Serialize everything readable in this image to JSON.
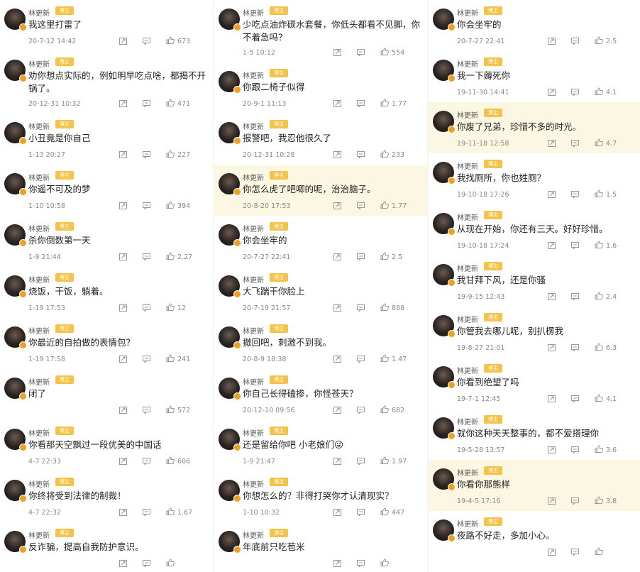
{
  "columns": [
    [
      {
        "name": "林更新",
        "badge": "博主",
        "text": "我这里打雷了",
        "date": "20-7-12 14:42",
        "likes": "673",
        "hl": false
      },
      {
        "name": "林更新",
        "badge": "博主",
        "text": "劝你想点实际的，例如明早吃点啥，都揭不开锅了。",
        "date": "20-12-31 10:32",
        "likes": "471",
        "hl": false,
        "tall": true
      },
      {
        "name": "林更新",
        "badge": "博主",
        "text": "小丑竟是你自己",
        "date": "1-13 20:27",
        "likes": "227",
        "hl": false
      },
      {
        "name": "林更新",
        "badge": "博主",
        "text": "你遥不可及的梦",
        "date": "1-10 10:58",
        "likes": "394",
        "hl": false
      },
      {
        "name": "林更新",
        "badge": "博主",
        "text": "杀你倒数第一天",
        "date": "1-9 21:44",
        "likes": "2.27",
        "hl": false
      },
      {
        "name": "林更新",
        "badge": "博主",
        "text": "烧饭，干饭，躺着。",
        "date": "1-19 17:53",
        "likes": "12",
        "hl": false
      },
      {
        "name": "林更新",
        "badge": "博主",
        "text": "你最近的自拍做的表情包？",
        "date": "1-19 17:58",
        "likes": "241",
        "hl": false
      },
      {
        "name": "林更新",
        "badge": "博主",
        "text": "闭了",
        "date": "",
        "likes": "572",
        "hl": false
      },
      {
        "name": "林更新",
        "badge": "博主",
        "text": "你看那天空飘过一段优美的中国话",
        "date": "4-7 22:33",
        "likes": "606",
        "hl": false
      },
      {
        "name": "林更新",
        "badge": "博主",
        "text": "你终将受到法律的制裁！",
        "date": "4-7 22:32",
        "likes": "1.67",
        "hl": false
      },
      {
        "name": "林更新",
        "badge": "博主",
        "text": "反诈骗，提高自我防护意识。",
        "date": "",
        "likes": "",
        "hl": false
      }
    ],
    [
      {
        "name": "林更新",
        "badge": "博主",
        "text": "少吃点油炸碳水套餐，你低头都看不见脚，你不着急吗？",
        "date": "1-5 10:12",
        "likes": "554",
        "hl": false,
        "tall": true
      },
      {
        "name": "林更新",
        "badge": "博主",
        "text": "你跟二椅子似得",
        "date": "20-9-1 11:13",
        "likes": "1.77",
        "hl": false
      },
      {
        "name": "林更新",
        "badge": "博主",
        "text": "报警吧，我忍他很久了",
        "date": "20-12-31 10:28",
        "likes": "233",
        "hl": false
      },
      {
        "name": "林更新",
        "badge": "博主",
        "text": "你怎么虎了吧唧的呢，治治脑子。",
        "date": "20-8-20 17:53",
        "likes": "1.77",
        "hl": true
      },
      {
        "name": "林更新",
        "badge": "博主",
        "text": "你会坐牢的",
        "date": "20-7-27 22:41",
        "likes": "2.5",
        "hl": false
      },
      {
        "name": "林更新",
        "badge": "博主",
        "text": "大飞踹干你脸上",
        "date": "20-7-19 21:57",
        "likes": "888",
        "hl": false
      },
      {
        "name": "林更新",
        "badge": "博主",
        "text": "撤回吧，刺激不到我。",
        "date": "20-8-9 18:38",
        "likes": "1.47",
        "hl": false
      },
      {
        "name": "林更新",
        "badge": "博主",
        "text": "你自己长得磕掺，你怪苍天？",
        "date": "20-12-10 09:56",
        "likes": "682",
        "hl": false
      },
      {
        "name": "林更新",
        "badge": "博主",
        "text": "还是留给你吧 小老娘们😜",
        "date": "1-9 21:47",
        "likes": "1.97",
        "hl": false
      },
      {
        "name": "林更新",
        "badge": "博主",
        "text": "你想怎么的？非得打哭你才认清现实？",
        "date": "1-10 10:32",
        "likes": "447",
        "hl": false
      },
      {
        "name": "林更新",
        "badge": "博主",
        "text": "年底前只吃苞米",
        "date": "",
        "likes": "",
        "hl": false
      }
    ],
    [
      {
        "name": "林更新",
        "badge": "博主",
        "text": "你会坐牢的",
        "date": "20-7-27 22:41",
        "likes": "2.5",
        "hl": false
      },
      {
        "name": "林更新",
        "badge": "博主",
        "text": "我一下薅死你",
        "date": "19-11-30 14:41",
        "likes": "4.1",
        "hl": false
      },
      {
        "name": "林更新",
        "badge": "博主",
        "text": "你废了兄弟，珍惜不多的时光。",
        "date": "19-11-18 12:58",
        "likes": "4.7",
        "hl": true
      },
      {
        "name": "林更新",
        "badge": "博主",
        "text": "我找厕所，你也姓厕？",
        "date": "19-10-18 17:26",
        "likes": "1.5",
        "hl": false
      },
      {
        "name": "林更新",
        "badge": "博主",
        "text": "从现在开始，你还有三天。好好珍惜。",
        "date": "19-10-18 17:24",
        "likes": "1.6",
        "hl": false
      },
      {
        "name": "林更新",
        "badge": "博主",
        "text": "我甘拜下风，还是你骚",
        "date": "19-9-15 12:43",
        "likes": "2.4",
        "hl": false
      },
      {
        "name": "林更新",
        "badge": "博主",
        "text": "你管我去哪儿呢，别扒楞我",
        "date": "19-8-27 21:01",
        "likes": "6.3",
        "hl": false
      },
      {
        "name": "林更新",
        "badge": "博主",
        "text": "你看到绝望了吗",
        "date": "19-7-1 12:45",
        "likes": "4.1",
        "hl": false
      },
      {
        "name": "林更新",
        "badge": "博主",
        "text": "就你这种天天整事的，都不爱搭理你",
        "date": "19-5-28 13:57",
        "likes": "3.6",
        "hl": false
      },
      {
        "name": "林更新",
        "badge": "博主",
        "text": "你看你那熊样",
        "date": "19-4-5 17:16",
        "likes": "3.8",
        "hl": true
      },
      {
        "name": "林更新",
        "badge": "博主",
        "text": "夜路不好走，多加小心。",
        "date": "",
        "likes": "",
        "hl": false
      }
    ]
  ],
  "icons": {
    "share": "share-icon",
    "comment": "comment-icon",
    "like": "thumbs-up-icon"
  },
  "colors": {
    "highlight": "#fbf7e3",
    "badge": "#f6c34a"
  }
}
